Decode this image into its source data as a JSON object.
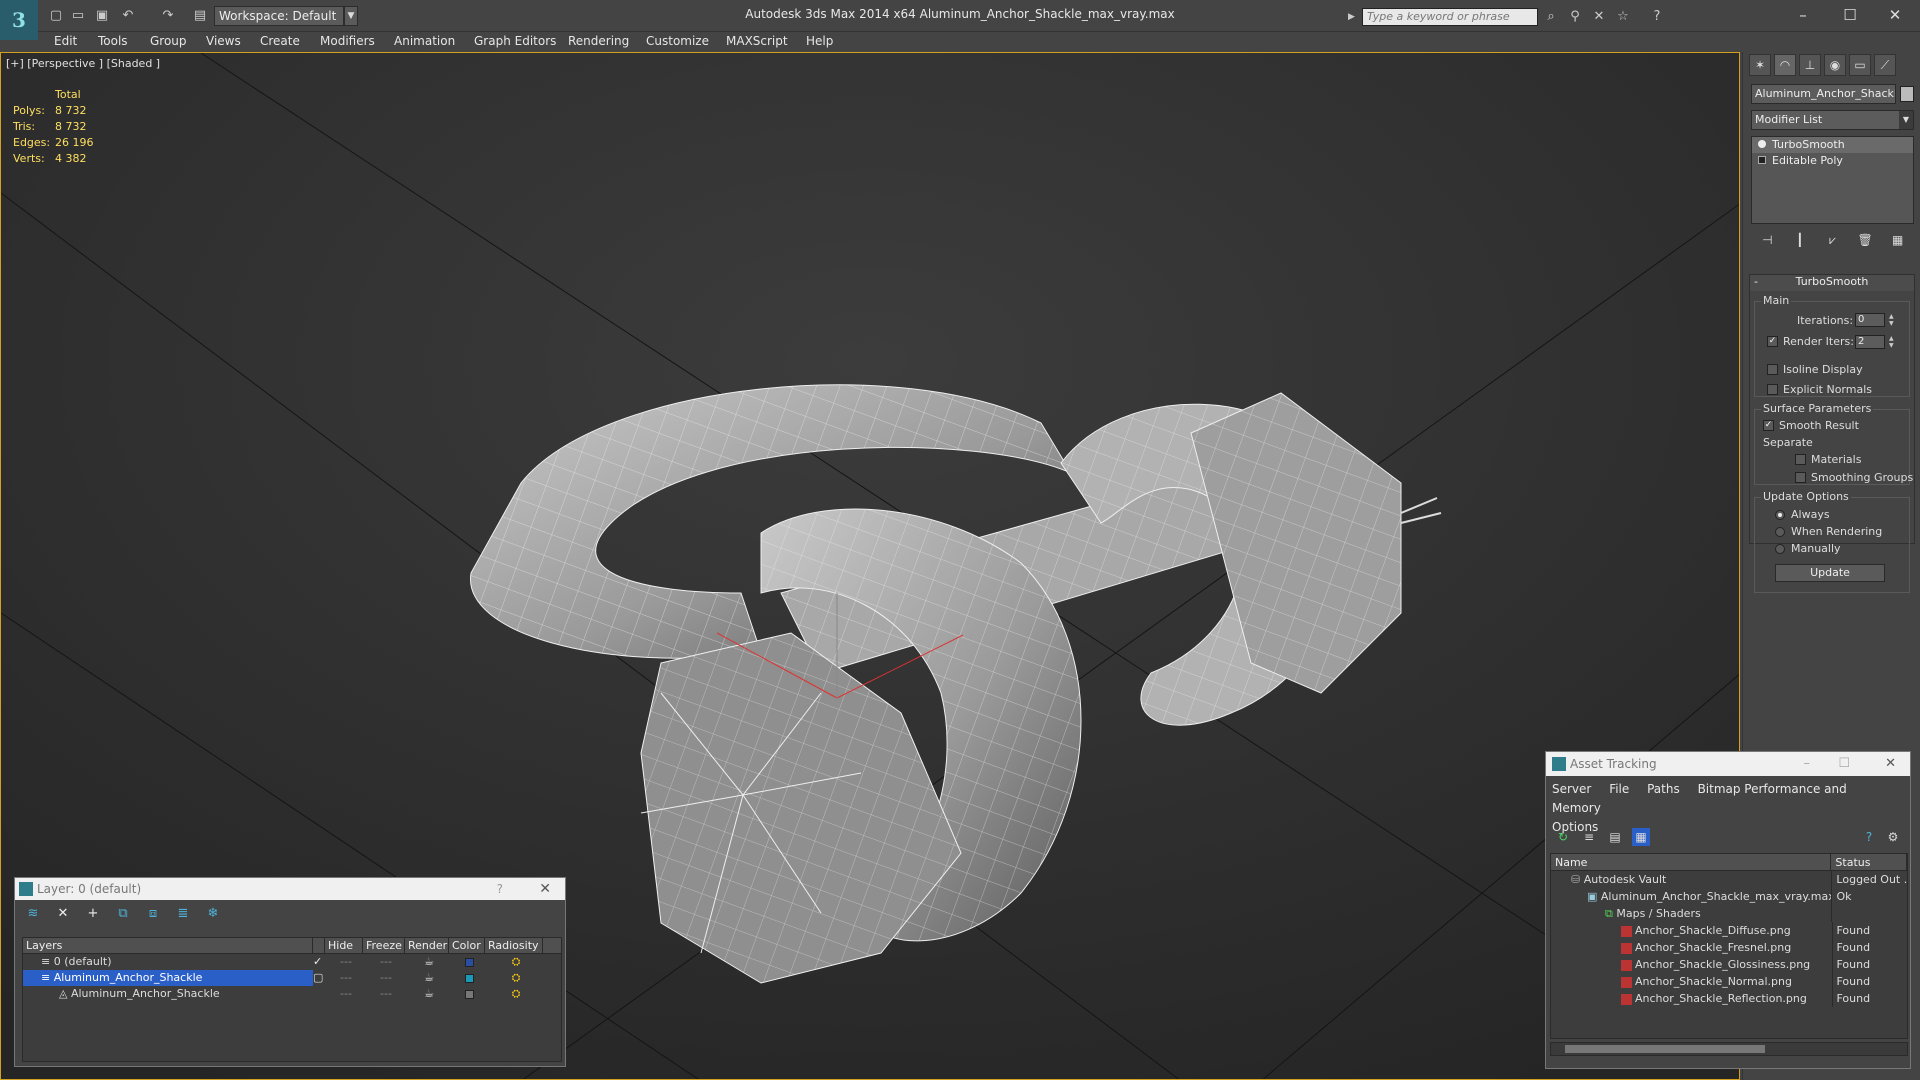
{
  "app": {
    "title": "Autodesk 3ds Max  2014 x64     Aluminum_Anchor_Shackle_max_vray.max",
    "logo_glyph": "3",
    "workspace": "Workspace: Default",
    "search_placeholder": "Type a keyword or phrase"
  },
  "menu": [
    "Edit",
    "Tools",
    "Group",
    "Views",
    "Create",
    "Modifiers",
    "Animation",
    "Graph Editors",
    "Rendering",
    "Customize",
    "MAXScript",
    "Help"
  ],
  "viewport": {
    "label": "[+] [Perspective ] [Shaded ]",
    "stats_header": "Total",
    "stats": [
      {
        "k": "Polys:",
        "v": "8 732"
      },
      {
        "k": "Tris:",
        "v": "8 732"
      },
      {
        "k": "Edges:",
        "v": "26 196"
      },
      {
        "k": "Verts:",
        "v": "4 382"
      }
    ],
    "border_color": "#d3a11e",
    "stats_color": "#ffdf60"
  },
  "command_panel": {
    "object_name": "Aluminum_Anchor_Shackle",
    "modifier_list": "Modifier List",
    "stack": [
      "TurboSmooth",
      "Editable Poly"
    ],
    "rollout_title": "TurboSmooth",
    "main_group": "Main",
    "iterations_label": "Iterations:",
    "iterations_value": "0",
    "render_iters_label": "Render Iters:",
    "render_iters_value": "2",
    "isoline": "Isoline Display",
    "explicit_normals": "Explicit Normals",
    "surface_group": "Surface Parameters",
    "smooth_result": "Smooth Result",
    "separate": "Separate",
    "materials": "Materials",
    "smoothing_groups": "Smoothing Groups",
    "update_group": "Update Options",
    "always": "Always",
    "when_rendering": "When Rendering",
    "manually": "Manually",
    "update_button": "Update"
  },
  "layer_panel": {
    "title": "Layer: 0 (default)",
    "help": "?",
    "columns": [
      "Layers",
      "Hide",
      "Freeze",
      "Render",
      "Color",
      "Radiosity"
    ],
    "rows": [
      {
        "name": "0 (default)",
        "color": "#2a4fa0"
      },
      {
        "name": "Aluminum_Anchor_Shackle",
        "color": "#1a9ab8"
      },
      {
        "name": "Aluminum_Anchor_Shackle",
        "color": "#777777"
      }
    ]
  },
  "asset_panel": {
    "title": "Asset Tracking",
    "menu": [
      "Server",
      "File",
      "Paths",
      "Bitmap Performance and Memory",
      "Options"
    ],
    "columns": [
      "Name",
      "Status"
    ],
    "rows": [
      {
        "name": "Autodesk Vault",
        "status": "Logged Out ..."
      },
      {
        "name": "Aluminum_Anchor_Shackle_max_vray.max",
        "status": "Ok"
      },
      {
        "name": "Maps / Shaders",
        "status": ""
      },
      {
        "name": "Anchor_Shackle_Diffuse.png",
        "status": "Found"
      },
      {
        "name": "Anchor_Shackle_Fresnel.png",
        "status": "Found"
      },
      {
        "name": "Anchor_Shackle_Glossiness.png",
        "status": "Found"
      },
      {
        "name": "Anchor_Shackle_Normal.png",
        "status": "Found"
      },
      {
        "name": "Anchor_Shackle_Reflection.png",
        "status": "Found"
      }
    ]
  }
}
